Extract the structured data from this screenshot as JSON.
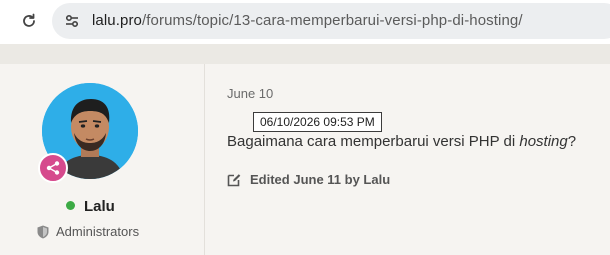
{
  "browser": {
    "url_host": "lalu.pro",
    "url_path": "/forums/topic/13-cara-memperbarui-versi-php-di-hosting/"
  },
  "author": {
    "name": "Lalu",
    "group": "Administrators",
    "status_color": "#3caa45",
    "badge_color": "#d64a8d"
  },
  "post": {
    "date": "June 10",
    "tooltip": "06/10/2026 09:53  PM",
    "text_before": "Bagaimana cara memperbarui versi PHP di ",
    "text_emphasis": "hosting",
    "text_after": "?",
    "edited_label": "Edited June 11 by Lalu"
  },
  "icons": {
    "reload": "reload-icon",
    "site_info": "tune-icon",
    "rank": "share-icon",
    "group": "shield-icon",
    "edit": "edit-icon"
  }
}
